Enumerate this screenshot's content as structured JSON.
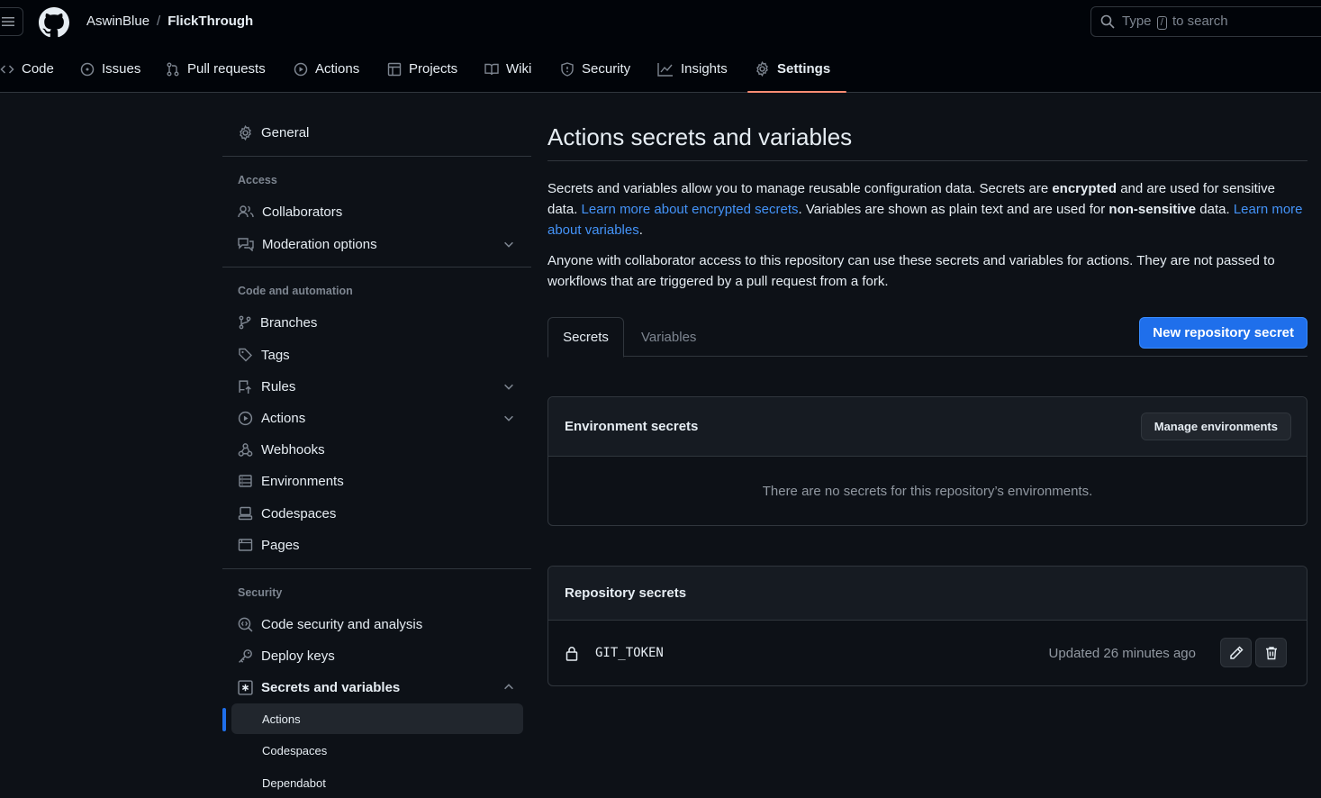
{
  "header": {
    "owner": "AswinBlue",
    "separator": "/",
    "repo": "FlickThrough",
    "search_prefix": "Type",
    "search_key": "/",
    "search_suffix": "to search"
  },
  "repo_nav": [
    {
      "label": "Code",
      "icon": "code-icon"
    },
    {
      "label": "Issues",
      "icon": "issue-icon"
    },
    {
      "label": "Pull requests",
      "icon": "pull-request-icon"
    },
    {
      "label": "Actions",
      "icon": "play-icon"
    },
    {
      "label": "Projects",
      "icon": "table-icon"
    },
    {
      "label": "Wiki",
      "icon": "book-icon"
    },
    {
      "label": "Security",
      "icon": "shield-icon"
    },
    {
      "label": "Insights",
      "icon": "graph-icon"
    },
    {
      "label": "Settings",
      "icon": "gear-icon",
      "active": true
    }
  ],
  "sidebar": {
    "general": "General",
    "access_heading": "Access",
    "collaborators": "Collaborators",
    "moderation": "Moderation options",
    "code_heading": "Code and automation",
    "branches": "Branches",
    "tags": "Tags",
    "rules": "Rules",
    "actions": "Actions",
    "webhooks": "Webhooks",
    "environments": "Environments",
    "codespaces": "Codespaces",
    "pages": "Pages",
    "security_heading": "Security",
    "code_security": "Code security and analysis",
    "deploy_keys": "Deploy keys",
    "secrets": "Secrets and variables",
    "sub_actions": "Actions",
    "sub_codespaces": "Codespaces",
    "sub_dependabot": "Dependabot"
  },
  "main": {
    "title": "Actions secrets and variables",
    "p1_a": "Secrets and variables allow you to manage reusable configuration data. Secrets are ",
    "p1_b": "encrypted",
    "p1_c": " and are used for sensitive data. ",
    "p1_link1": "Learn more about encrypted secrets",
    "p1_d": ". Variables are shown as plain text and are used for ",
    "p1_e": "non-sensitive",
    "p1_f": " data. ",
    "p1_link2": "Learn more about variables",
    "p1_g": ".",
    "p2": "Anyone with collaborator access to this repository can use these secrets and variables for actions. They are not passed to workflows that are triggered by a pull request from a fork.",
    "tab_secrets": "Secrets",
    "tab_variables": "Variables",
    "new_secret_button": "New repository secret",
    "env_title": "Environment secrets",
    "manage_env_button": "Manage environments",
    "env_empty": "There are no secrets for this repository’s environments.",
    "repo_title": "Repository secrets",
    "secret_name": "GIT_TOKEN",
    "secret_updated": "Updated 26 minutes ago"
  },
  "colors": {
    "background": "#0d1117",
    "accent": "#1f6feb",
    "link": "#4493f8",
    "active_tab_underline": "#fd8c73"
  }
}
